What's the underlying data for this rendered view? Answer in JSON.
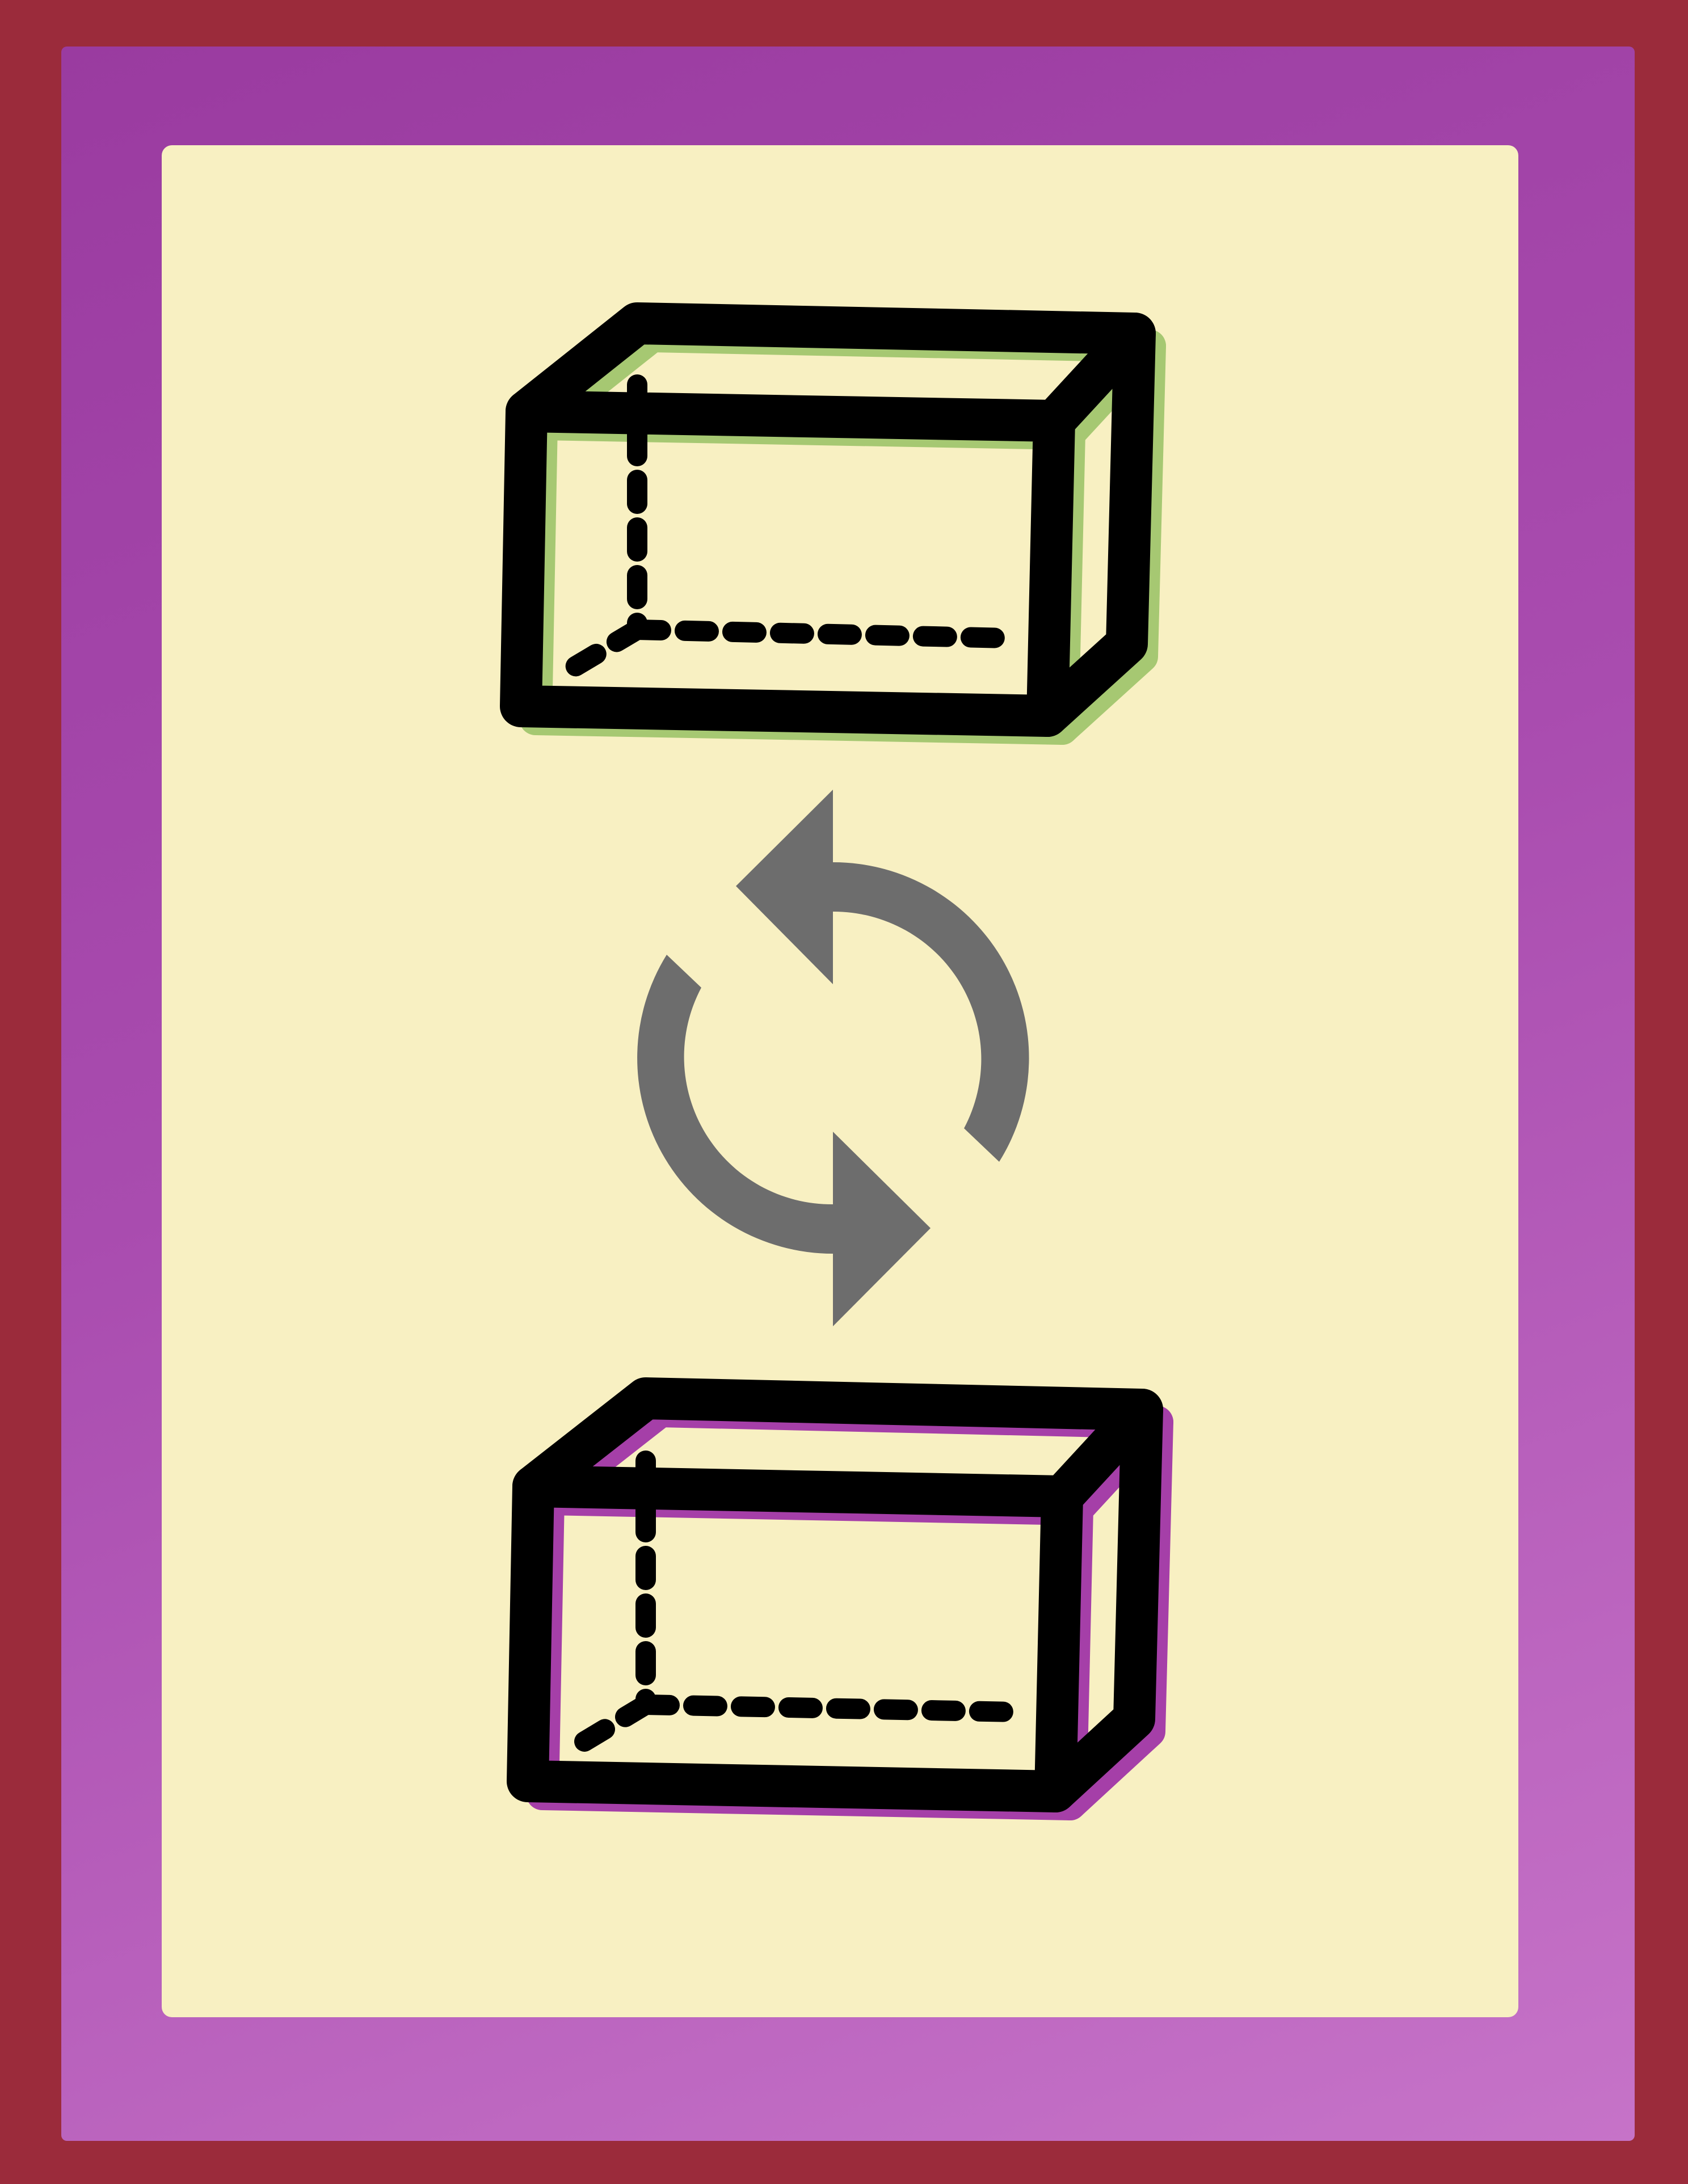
{
  "colors": {
    "outer_frame": "#9b2b3b",
    "inner_frame": "#a94caf",
    "card_background": "#f8f0c2",
    "top_box_accent": "#a6c872",
    "bottom_box_accent": "#a53fa8",
    "outline": "#000000",
    "swap_arrows": "#6d6d6d"
  },
  "icons": {
    "top_box": "cuboid-outline-icon",
    "swap": "refresh-cycle-arrows-icon",
    "bottom_box": "cuboid-outline-icon"
  }
}
